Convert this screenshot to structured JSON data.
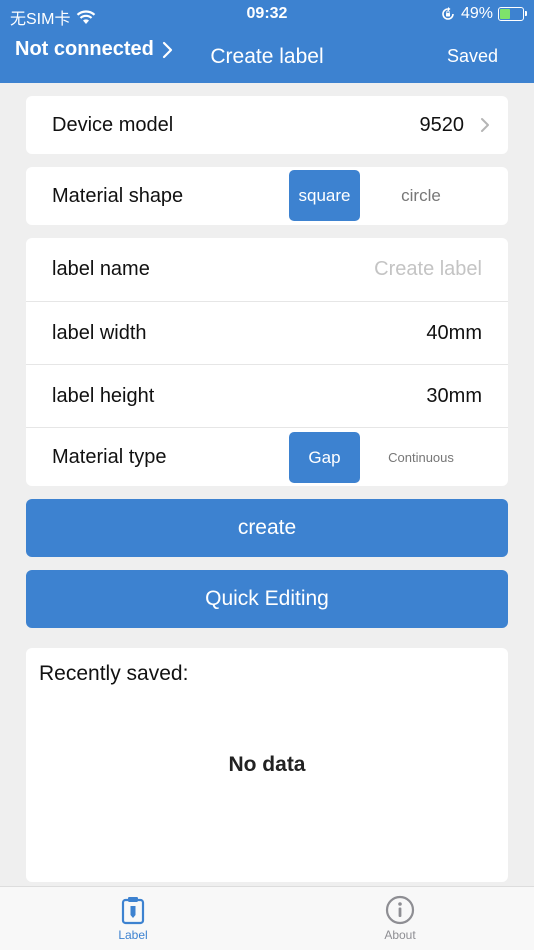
{
  "status_bar": {
    "carrier": "无SIM卡",
    "time": "09:32",
    "battery_percent": "49%",
    "battery_level": 0.49
  },
  "nav": {
    "left_label": "Not connected",
    "title": "Create label",
    "right_label": "Saved"
  },
  "device": {
    "label": "Device model",
    "value": "9520"
  },
  "shape": {
    "label": "Material shape",
    "options": [
      "square",
      "circle"
    ],
    "selected": "square"
  },
  "label_settings": {
    "name_label": "label name",
    "name_placeholder": "Create label",
    "width_label": "label width",
    "width_value": "40mm",
    "height_label": "label height",
    "height_value": "30mm",
    "type_label": "Material type",
    "type_options": [
      "Gap",
      "Continuous"
    ],
    "type_selected": "Gap"
  },
  "actions": {
    "create_label": "create",
    "quick_edit_label": "Quick Editing"
  },
  "recent": {
    "title": "Recently saved:",
    "empty_text": "No data"
  },
  "tabs": [
    {
      "label": "Label",
      "icon": "label-icon",
      "active": true
    },
    {
      "label": "About",
      "icon": "info-icon",
      "active": false
    }
  ],
  "colors": {
    "accent": "#3d82d0",
    "background": "#efefef",
    "tab_active": "#3d82d0",
    "tab_inactive": "#8e8e93"
  }
}
